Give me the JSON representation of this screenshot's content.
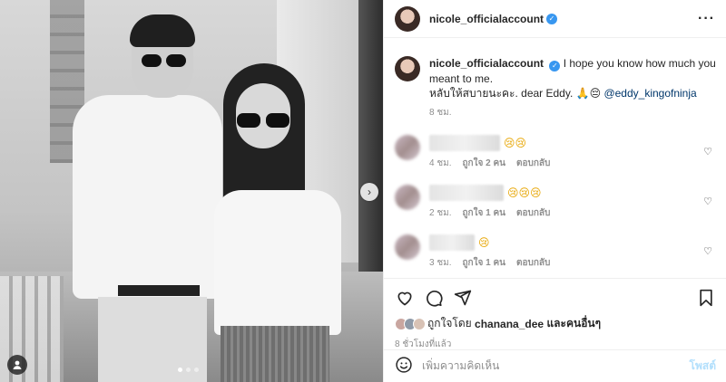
{
  "post": {
    "username": "nicole_officialaccount",
    "more_icon": "more-horizontal-icon"
  },
  "caption": {
    "username": "nicole_officialaccount",
    "text_line1": "I hope you know how much you meant to me.",
    "text_line2": "หลับให้สบายนะคะ. dear Eddy. 🙏😔",
    "mention": "@eddy_kingofninja",
    "time": "8 ชม."
  },
  "comments": [
    {
      "emoji": "😢😢",
      "time": "4 ชม.",
      "likes": "ถูกใจ 2 คน",
      "reply": "ตอบกลับ"
    },
    {
      "emoji": "😢😢😢",
      "time": "2 ชม.",
      "likes": "ถูกใจ 1 คน",
      "reply": "ตอบกลับ"
    },
    {
      "emoji": "😢",
      "time": "3 ชม.",
      "likes": "ถูกใจ 1 คน",
      "reply": "ตอบกลับ"
    },
    {
      "emoji": "♡♡♡♡",
      "time": "",
      "likes": "",
      "reply": ""
    }
  ],
  "likes": {
    "prefix": "ถูกใจโดย",
    "user": "chanana_dee",
    "suffix": "และคนอื่นๆ"
  },
  "post_time": "8 ชั่วโมงที่แล้ว",
  "add_comment": {
    "placeholder": "เพิ่มความคิดเห็น",
    "post_label": "โพสต์"
  },
  "colors": {
    "verified": "#3897f0",
    "mention": "#00376b",
    "post_button": "#b2dffc"
  },
  "carousel": {
    "total": 3,
    "current": 1
  }
}
